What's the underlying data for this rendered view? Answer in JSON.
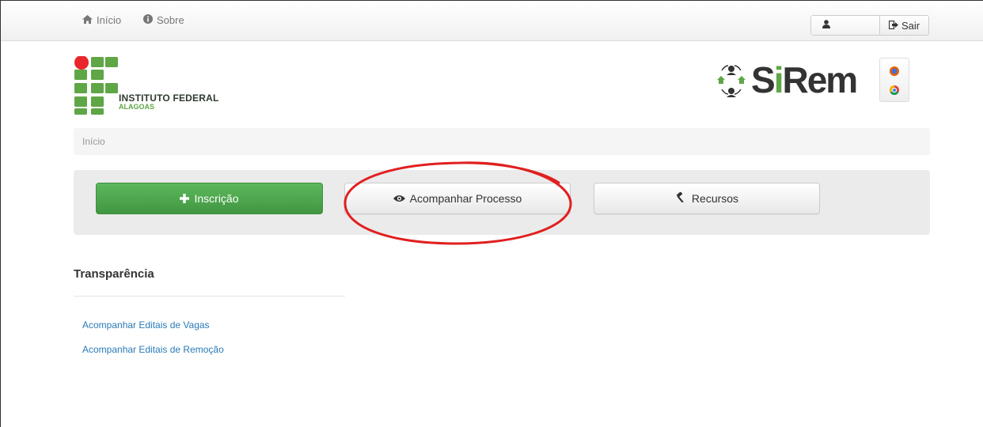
{
  "navbar": {
    "home_label": "Início",
    "home_icon": "home-icon",
    "about_label": "Sobre",
    "about_icon": "info-circle-icon",
    "user_icon": "user-icon",
    "logout_label": "Sair",
    "logout_icon": "logout-icon"
  },
  "logos": {
    "institution_line1": "INSTITUTO FEDERAL",
    "institution_line2": "ALAGOAS",
    "app_name": "SiRem",
    "browsers": [
      "firefox-icon",
      "chrome-icon"
    ]
  },
  "breadcrumb": {
    "current": "Início"
  },
  "actions": {
    "inscricao_label": "Inscrição",
    "acompanhar_label": "Acompanhar Processo",
    "recursos_label": "Recursos"
  },
  "transparency": {
    "title": "Transparência",
    "links": [
      "Acompanhar Editais de Vagas",
      "Acompanhar Editais de Remoção"
    ]
  },
  "colors": {
    "primary_green": "#5cb85c",
    "link_blue": "#2a7ab7",
    "annotation_red": "#e02020",
    "brand_green": "#5fa646",
    "brand_red": "#e8262c"
  }
}
